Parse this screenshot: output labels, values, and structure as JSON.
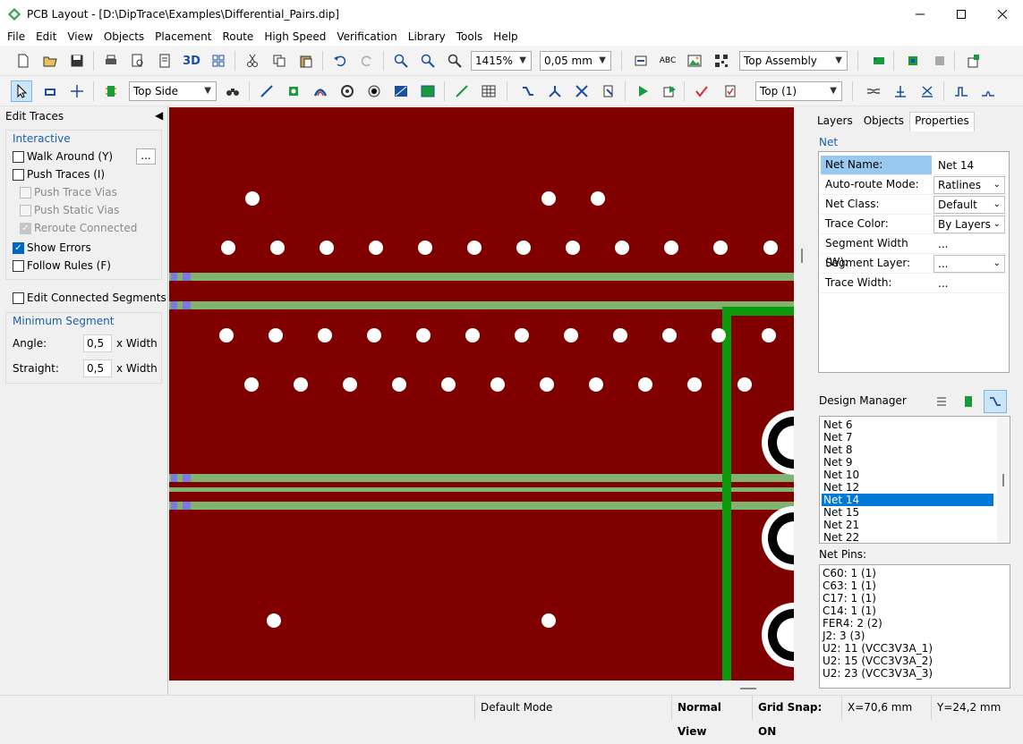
{
  "window": {
    "title": "PCB Layout - [D:\\DipTrace\\Examples\\Differential_Pairs.dip]",
    "controls": [
      "minimize",
      "maximize",
      "close"
    ]
  },
  "menu": [
    "File",
    "Edit",
    "View",
    "Objects",
    "Placement",
    "Route",
    "High Speed",
    "Verification",
    "Library",
    "Tools",
    "Help"
  ],
  "toolbar1": {
    "zoom_value": "1415%",
    "grid_value": "0,05 mm",
    "layer_view": "Top Assembly",
    "view_3d_label": "3D"
  },
  "toolbar2": {
    "side_value": "Top Side",
    "layer_value": "Top (1)"
  },
  "edit_traces": {
    "title": "Edit Traces",
    "interactive_title": "Interactive",
    "options": [
      {
        "label": "Walk Around (Y)",
        "checked": false,
        "disabled": false
      },
      {
        "label": "Push Traces (I)",
        "checked": false,
        "disabled": false
      },
      {
        "label": "Push Trace Vias",
        "checked": false,
        "disabled": true
      },
      {
        "label": "Push Static Vias",
        "checked": false,
        "disabled": true
      },
      {
        "label": "Reroute Connected",
        "checked": true,
        "disabled": true
      },
      {
        "label": "Show Errors",
        "checked": true,
        "disabled": false
      },
      {
        "label": "Follow Rules (F)",
        "checked": false,
        "disabled": false
      }
    ],
    "more_button": "...",
    "edit_connected": "Edit Connected Segments",
    "min_segment_title": "Minimum Segment",
    "angle_label": "Angle:",
    "angle_value": "0,5",
    "straight_label": "Straight:",
    "straight_value": "0,5",
    "unit": "x Width"
  },
  "right_panel": {
    "tabs": [
      "Layers",
      "Objects",
      "Properties"
    ],
    "active_tab": "Properties",
    "section": "Net",
    "properties": [
      {
        "label": "Net Name:",
        "value": "Net 14",
        "dropdown": false
      },
      {
        "label": "Auto-route Mode:",
        "value": "Ratlines",
        "dropdown": true
      },
      {
        "label": "Net Class:",
        "value": "Default",
        "dropdown": true
      },
      {
        "label": "Trace Color:",
        "value": "By Layers",
        "dropdown": true
      },
      {
        "label": "Segment Width (W):",
        "value": "...",
        "dropdown": false
      },
      {
        "label": "Segment Layer:",
        "value": "...",
        "dropdown": true
      },
      {
        "label": "Trace Width:",
        "value": "...",
        "dropdown": false
      }
    ],
    "design_manager_title": "Design Manager",
    "nets": [
      "Net 6",
      "Net 7",
      "Net 8",
      "Net 9",
      "Net 10",
      "Net 12",
      "Net 14",
      "Net 15",
      "Net 21",
      "Net 22"
    ],
    "selected_net": "Net 14",
    "net_pins_title": "Net Pins:",
    "net_pins": [
      "C60: 1 (1)",
      "C63: 1 (1)",
      "C17: 1 (1)",
      "C14: 1 (1)",
      "FER4: 2 (2)",
      "J2: 3 (3)",
      "U2: 11 (VCC3V3A_1)",
      "U2: 15 (VCC3V3A_2)",
      "U2: 23 (VCC3V3A_3)"
    ]
  },
  "statusbar": {
    "mode": "Default Mode",
    "view": "Normal View",
    "grid_snap": "Grid Snap: ON",
    "x": "X=70,6 mm",
    "y": "Y=24,2 mm"
  },
  "colors": {
    "board": "#800000",
    "trace_green": "#7fb36f",
    "trace_bright": "#0b9a0b",
    "pad_blue": "#7a7ae0",
    "hole": "#ffffff",
    "selection": "#0078d7"
  }
}
